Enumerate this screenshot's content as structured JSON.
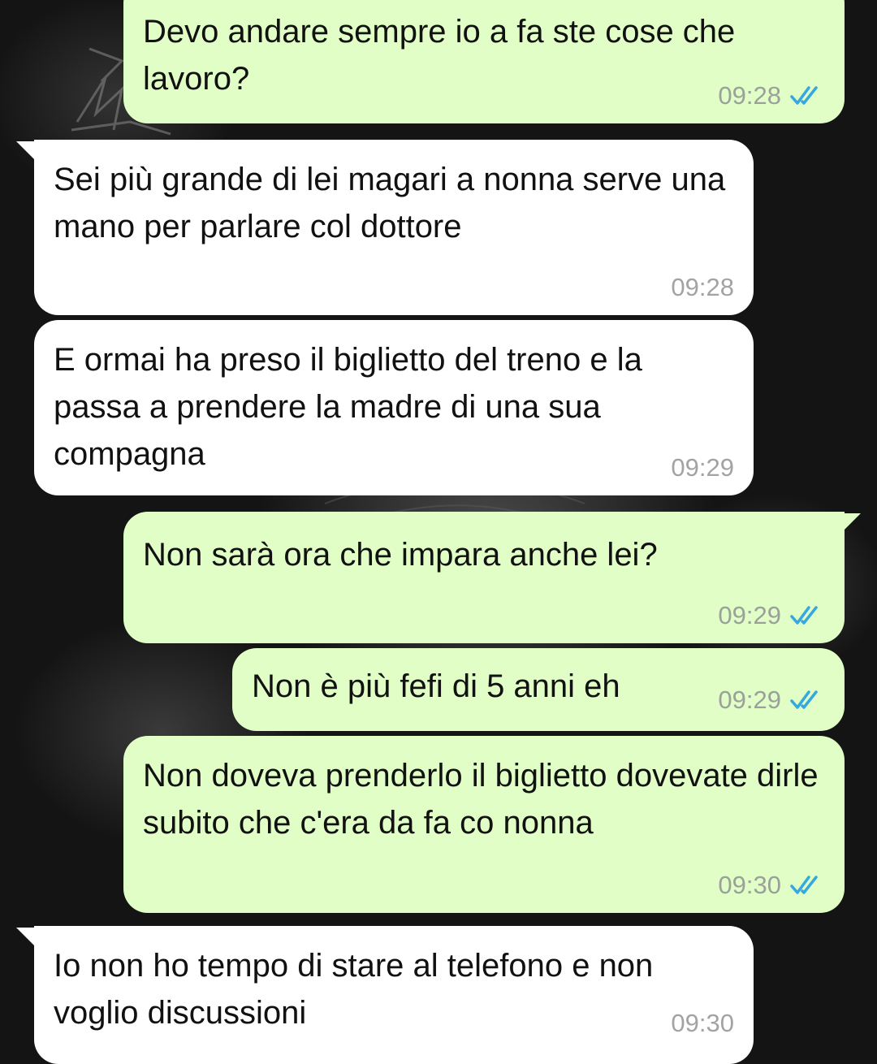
{
  "messages": [
    {
      "id": "m1",
      "direction": "outgoing",
      "text": "Devo andare sempre io a fa ste cose che lavoro?",
      "time": "09:28",
      "status": "read"
    },
    {
      "id": "m2",
      "direction": "incoming",
      "text": "Sei più grande di lei magari a nonna serve una mano per parlare col dottore",
      "time": "09:28"
    },
    {
      "id": "m3",
      "direction": "incoming",
      "text": "E ormai ha preso il biglietto del treno e la passa a prendere la madre di una sua compagna",
      "time": "09:29"
    },
    {
      "id": "m4",
      "direction": "outgoing",
      "text": "Non sarà ora che impara anche lei?",
      "time": "09:29",
      "status": "read"
    },
    {
      "id": "m5",
      "direction": "outgoing",
      "text": "Non è più fefi di 5 anni eh",
      "time": "09:29",
      "status": "read"
    },
    {
      "id": "m6",
      "direction": "outgoing",
      "text": "Non doveva prenderlo il biglietto dovevate dirle subito che c'era da fa co nonna",
      "time": "09:30",
      "status": "read"
    },
    {
      "id": "m7",
      "direction": "incoming",
      "text": "Io non ho tempo di stare al telefono e non voglio discussioni",
      "time": "09:30"
    }
  ],
  "icons": {
    "read_receipt": "double-check-icon"
  },
  "colors": {
    "outgoing_bubble": "#e1fec6",
    "incoming_bubble": "#ffffff",
    "read_tick": "#35a8e0",
    "timestamp": "#9aa19a",
    "background": "#141414"
  }
}
